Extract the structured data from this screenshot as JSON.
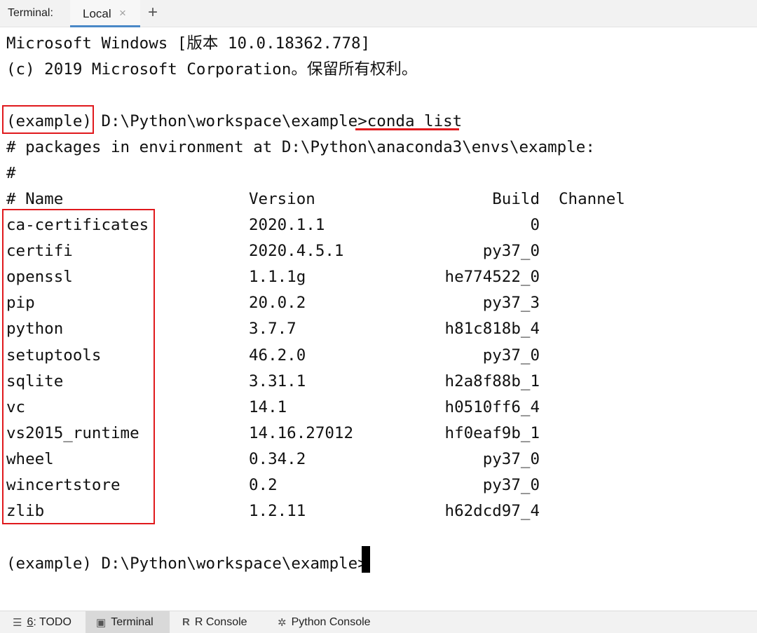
{
  "tabbar": {
    "label": "Terminal:",
    "tab_label": "Local",
    "close_glyph": "×",
    "add_glyph": "+"
  },
  "terminal": {
    "header_lines": [
      "Microsoft Windows [版本 10.0.18362.778]",
      "(c) 2019 Microsoft Corporation。保留所有权利。"
    ],
    "prompt_env": "(example)",
    "prompt_path": " D:\\Python\\workspace\\example>",
    "command": "conda list",
    "info_line": "# packages in environment at D:\\Python\\anaconda3\\envs\\example:",
    "hash_line": "#",
    "columns": [
      "# Name",
      "Version",
      "Build",
      "Channel"
    ],
    "packages": [
      {
        "name": "ca-certificates",
        "version": "2020.1.1",
        "build": "0"
      },
      {
        "name": "certifi",
        "version": "2020.4.5.1",
        "build": "py37_0"
      },
      {
        "name": "openssl",
        "version": "1.1.1g",
        "build": "he774522_0"
      },
      {
        "name": "pip",
        "version": "20.0.2",
        "build": "py37_3"
      },
      {
        "name": "python",
        "version": "3.7.7",
        "build": "h81c818b_4"
      },
      {
        "name": "setuptools",
        "version": "46.2.0",
        "build": "py37_0"
      },
      {
        "name": "sqlite",
        "version": "3.31.1",
        "build": "h2a8f88b_1"
      },
      {
        "name": "vc",
        "version": "14.1",
        "build": "h0510ff6_4"
      },
      {
        "name": "vs2015_runtime",
        "version": "14.16.27012",
        "build": "hf0eaf9b_1"
      },
      {
        "name": "wheel",
        "version": "0.34.2",
        "build": "py37_0"
      },
      {
        "name": "wincertstore",
        "version": "0.2",
        "build": "py37_0"
      },
      {
        "name": "zlib",
        "version": "1.2.11",
        "build": "h62dcd97_4"
      }
    ],
    "final_prompt": "(example) D:\\Python\\workspace\\example>"
  },
  "bottombar": {
    "todo_num": "6",
    "todo_label": ": TODO",
    "terminal_label": "Terminal",
    "r_console_label": "R Console",
    "python_console_label": "Python Console"
  },
  "colors": {
    "highlight_red": "#e0191d",
    "active_tab_blue": "#4a88c7"
  }
}
